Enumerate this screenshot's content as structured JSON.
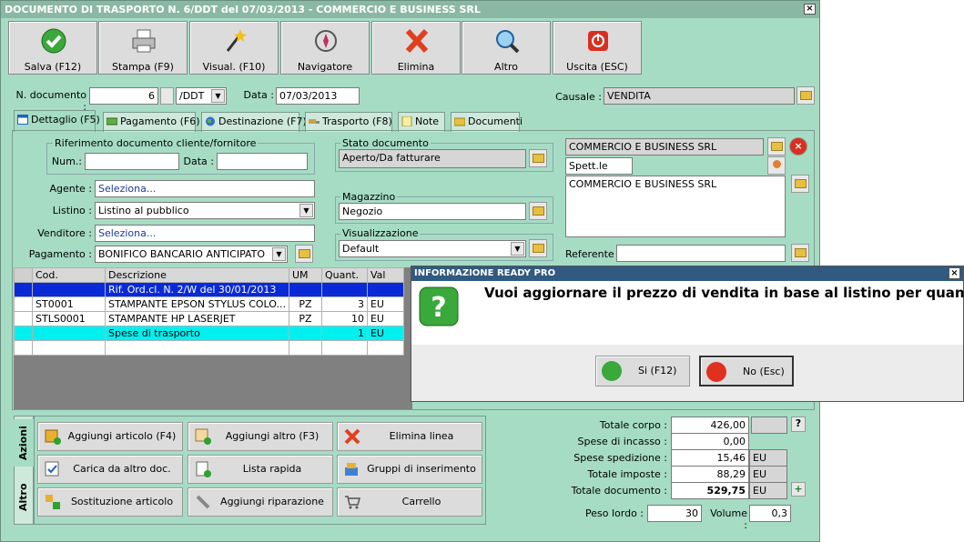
{
  "window": {
    "title": "DOCUMENTO DI TRASPORTO N. 6/DDT del 07/03/2013 - COMMERCIO E BUSINESS SRL",
    "close": "×"
  },
  "toolbar": [
    {
      "label": "Salva (F12)",
      "icon": "check-icon"
    },
    {
      "label": "Stampa (F9)",
      "icon": "printer-icon"
    },
    {
      "label": "Visual. (F10)",
      "icon": "magic-wand-icon"
    },
    {
      "label": "Navigatore",
      "icon": "compass-icon"
    },
    {
      "label": "Elimina",
      "icon": "delete-x-icon"
    },
    {
      "label": "Altro",
      "icon": "magnifier-icon"
    },
    {
      "label": "Uscita (ESC)",
      "icon": "power-icon"
    }
  ],
  "header": {
    "num_label": "N. documento :",
    "num_value": "6",
    "series_value": "/DDT",
    "date_label": "Data :",
    "date_value": "07/03/2013",
    "causale_label": "Causale :",
    "causale_value": "VENDITA"
  },
  "tabs": [
    "Dettaglio (F5)",
    "Pagamento (F6)",
    "Destinazione (F7)",
    "Trasporto (F8)",
    "Note",
    "Documenti"
  ],
  "rif": {
    "title": "Riferimento documento cliente/fornitore",
    "num_label": "Num.:",
    "num_value": "",
    "data_label": "Data :",
    "data_value": ""
  },
  "fields": {
    "agente_label": "Agente :",
    "agente_value": "Seleziona...",
    "listino_label": "Listino :",
    "listino_value": "Listino al pubblico",
    "venditore_label": "Venditore :",
    "venditore_value": "Seleziona...",
    "pagamento_label": "Pagamento :",
    "pagamento_value": "BONIFICO BANCARIO ANTICIPATO"
  },
  "stato": {
    "title": "Stato documento",
    "value": "Aperto/Da fatturare"
  },
  "magazzino": {
    "title": "Magazzino",
    "value": "Negozio"
  },
  "visualizzazione": {
    "title": "Visualizzazione",
    "value": "Default"
  },
  "cliente": {
    "name": "COMMERCIO E BUSINESS SRL",
    "salutation": "Spett.le",
    "address": "COMMERCIO E BUSINESS SRL",
    "referente_label": "Referente",
    "referente_value": ""
  },
  "grid": {
    "headers": [
      "Cod.",
      "Descrizione",
      "UM",
      "Quant.",
      "Val"
    ],
    "rows": [
      [
        "",
        "Rif. Ord.cl. N. 2/W del 30/01/2013",
        "",
        "",
        ""
      ],
      [
        "ST0001",
        "STAMPANTE EPSON STYLUS COLO...",
        "PZ",
        "3",
        "EU"
      ],
      [
        "STLS0001",
        "STAMPANTE HP LASERJET",
        "PZ",
        "10",
        "EU"
      ],
      [
        "",
        "Spese di trasporto",
        "",
        "1",
        "EU"
      ],
      [
        "",
        "",
        "",
        "",
        ""
      ]
    ]
  },
  "side_tabs": {
    "azioni": "Azioni",
    "altro": "Altro"
  },
  "actions": [
    "Aggiungi articolo (F4)",
    "Aggiungi altro (F3)",
    "Elimina linea",
    "Carica da altro doc.",
    "Lista rapida",
    "Gruppi di inserimento",
    "Sostituzione articolo",
    "Aggiungi riparazione",
    "Carrello"
  ],
  "totals": {
    "corpo_label": "Totale corpo :",
    "corpo": "426,00",
    "help": "?",
    "incasso_label": "Spese di incasso :",
    "incasso": "0,00",
    "spedizione_label": "Spese spedizione :",
    "spedizione": "15,46",
    "spedizione_cur": "EU",
    "imposte_label": "Totale imposte :",
    "imposte": "88,29",
    "imposte_cur": "EU",
    "documento_label": "Totale documento :",
    "documento": "529,75",
    "documento_cur": "EU",
    "peso_label": "Peso lordo :",
    "peso": "30",
    "volume_label": "Volume :",
    "volume": "0,3"
  },
  "dialog": {
    "title": "INFORMAZIONE READY PRO",
    "message": "Vuoi aggiornare il prezzo di vendita in base al listino per quantita'?",
    "yes": "Si (F12)",
    "no": "No (Esc)",
    "close": "×"
  }
}
